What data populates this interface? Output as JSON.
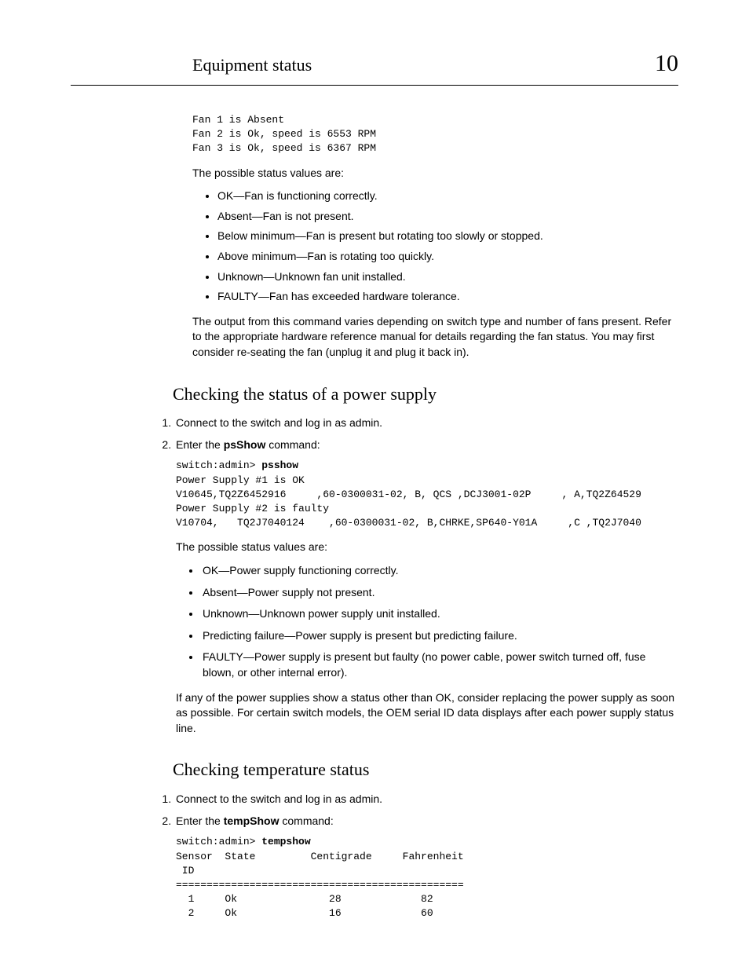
{
  "header": {
    "title": "Equipment status",
    "chapter": "10"
  },
  "fan_output": "Fan 1 is Absent\nFan 2 is Ok, speed is 6553 RPM\nFan 3 is Ok, speed is 6367 RPM",
  "fan_intro": "The possible status values are:",
  "fan_values": [
    "OK—Fan is functioning correctly.",
    "Absent—Fan is not present.",
    "Below minimum—Fan is present but rotating too slowly or stopped.",
    "Above minimum—Fan is rotating too quickly.",
    "Unknown—Unknown fan unit installed.",
    "FAULTY—Fan has exceeded hardware tolerance."
  ],
  "fan_note": "The output from this command varies depending on switch type and number of fans present. Refer to the appropriate hardware reference manual for details regarding the fan status. You may first consider re-seating the fan (unplug it and plug it back in).",
  "ps_heading": "Checking the status of a power supply",
  "ps_step1": "Connect to the switch and log in as admin.",
  "ps_step2_pre": "Enter the ",
  "ps_step2_cmd": "psShow",
  "ps_step2_post": " command:",
  "ps_prompt": "switch:admin> ",
  "ps_command": "psshow",
  "ps_output": "\nPower Supply #1 is OK\nV10645,TQ2Z6452916     ,60-0300031-02, B, QCS ,DCJ3001-02P     , A,TQ2Z64529\nPower Supply #2 is faulty\nV10704,   TQ2J7040124    ,60-0300031-02, B,CHRKE,SP640-Y01A     ,C ,TQ2J7040",
  "ps_intro": "The possible status values are:",
  "ps_values": [
    "OK—Power supply functioning correctly.",
    "Absent—Power supply not present.",
    "Unknown—Unknown power supply unit installed.",
    "Predicting failure—Power supply is present but predicting failure.",
    "FAULTY—Power supply is present but faulty (no power cable, power switch turned off, fuse blown, or other internal error)."
  ],
  "ps_note": "If any of the power supplies show a status other than OK, consider replacing the power supply as soon as possible. For certain switch models, the OEM serial ID data displays after each power supply status line.",
  "temp_heading": "Checking temperature status",
  "temp_step1": "Connect to the switch and log in as admin.",
  "temp_step2_pre": "Enter the ",
  "temp_step2_cmd": "tempShow",
  "temp_step2_post": " command:",
  "temp_prompt": "switch:admin> ",
  "temp_command": "tempshow",
  "temp_output": "Sensor  State         Centigrade     Fahrenheit\n ID\n===============================================\n  1     Ok               28             82\n  2     Ok               16             60"
}
